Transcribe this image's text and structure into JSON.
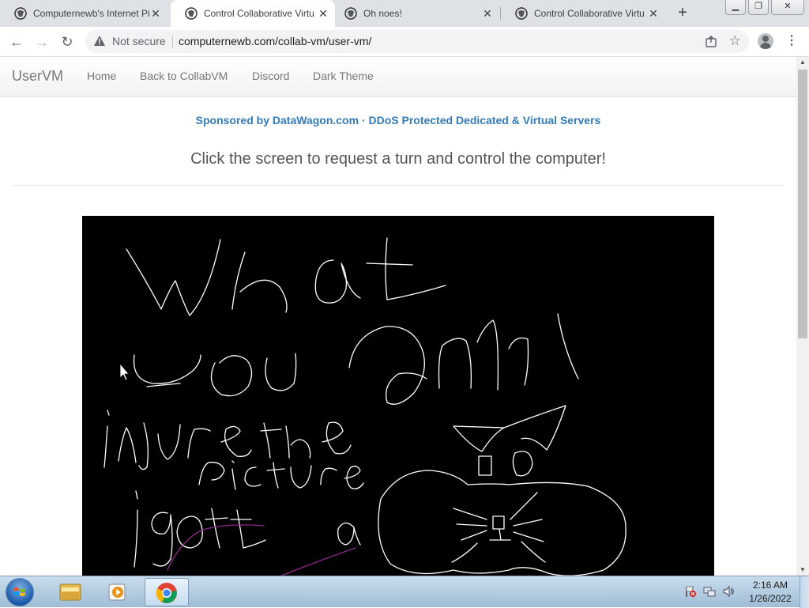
{
  "browser": {
    "tabs": [
      {
        "title": "Computernewb's Internet Pi",
        "active": false
      },
      {
        "title": "Control Collaborative Virtu",
        "active": true
      },
      {
        "title": "Oh noes!",
        "active": false
      },
      {
        "title": "Control Collaborative Virtu",
        "active": false
      }
    ],
    "new_tab_icon": "+",
    "security_label": "Not secure",
    "url": "computernewb.com/collab-vm/user-vm/",
    "window_buttons": [
      "minimize",
      "restore",
      "close"
    ]
  },
  "page": {
    "brand": "UserVM",
    "nav": [
      "Home",
      "Back to CollabVM",
      "Discord",
      "Dark Theme"
    ],
    "sponsor": "Sponsored by DataWagon.com · DDoS Protected Dedicated & Virtual Servers",
    "headline": "Click the screen to request a turn and control the computer!",
    "vm_screen_background": "#000000"
  },
  "taskbar": {
    "time": "2:16 AM",
    "date": "1/26/2022"
  }
}
